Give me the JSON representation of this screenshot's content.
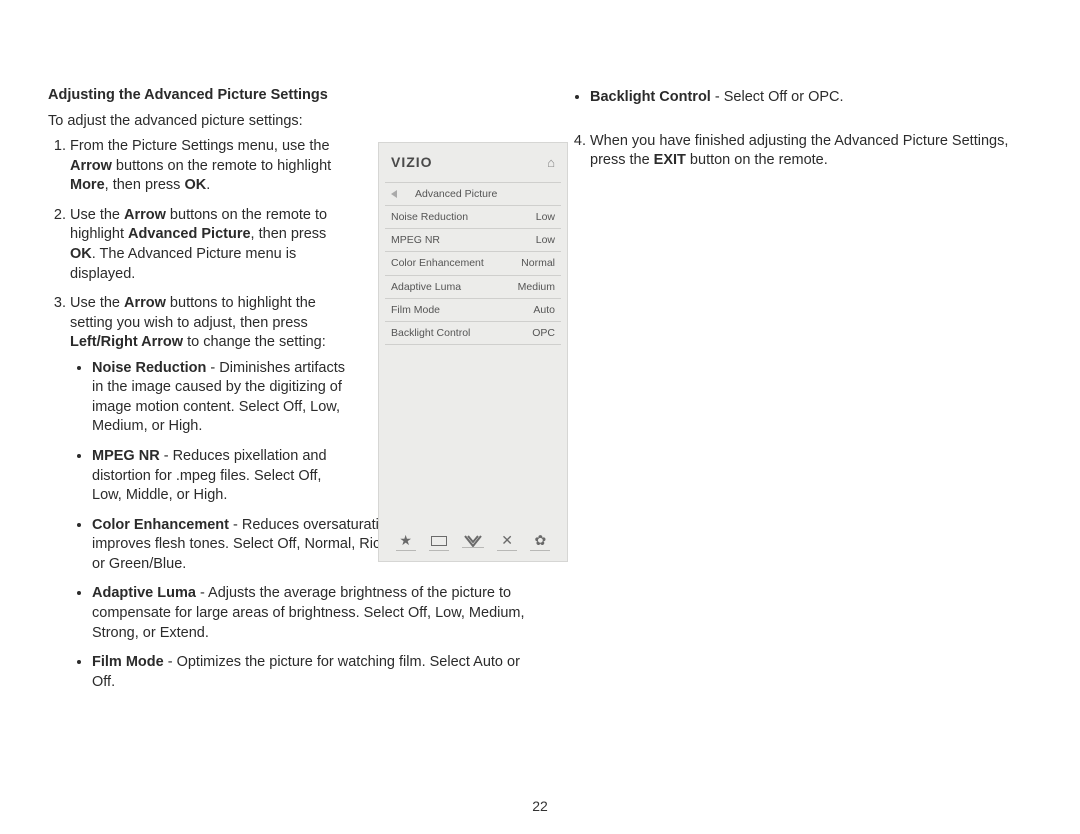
{
  "left": {
    "title": "Adjusting the Advanced Picture Settings",
    "intro": "To adjust the advanced picture settings:",
    "step1_a": "From the Picture Settings menu, use the ",
    "step1_arrow": "Arrow",
    "step1_b": " buttons on the remote to highlight ",
    "step1_more": "More",
    "step1_c": ", then press ",
    "step1_ok": "OK",
    "step1_d": ".",
    "step2_a": "Use the ",
    "step2_arrow": "Arrow",
    "step2_b": " buttons on the remote to highlight ",
    "step2_adv": "Advanced Picture",
    "step2_c": ", then press ",
    "step2_ok": "OK",
    "step2_d": ". The Advanced Picture menu is displayed.",
    "step3_a": "Use the ",
    "step3_arrow": "Arrow",
    "step3_b": " buttons to highlight the setting you wish to adjust, then press ",
    "step3_lr": "Left/Right Arrow",
    "step3_c": " to change the setting:",
    "opt_nr_label": "Noise Reduction",
    "opt_nr_sep": " - ",
    "opt_nr_body": "Diminishes artifacts in the image caused by the digitizing of image motion content. Select Off, Low, Medium, or High.",
    "opt_mpeg_label": "MPEG NR",
    "opt_mpeg_sep": " - ",
    "opt_mpeg_body": "Reduces pixellation and distortion for .mpeg files. Select Off, Low, Middle, or High.",
    "opt_ce_label": "Color Enhancement",
    "opt_ce_sep": " - ",
    "opt_ce_body": "Reduces oversaturation of some colors and improves flesh tones. Select Off, Normal, Rich Color, Green/Flesh, or Green/Blue.",
    "opt_al_label": "Adaptive Luma",
    "opt_al_sep": " - ",
    "opt_al_body": "Adjusts the average brightness of the picture to compensate for large areas of brightness. Select Off, Low, Medium, Strong, or Extend.",
    "opt_fm_label": "Film Mode",
    "opt_fm_sep": " - ",
    "opt_fm_body": "Optimizes the picture for watching film. Select Auto or Off."
  },
  "right": {
    "opt_bl_label": "Backlight Control",
    "opt_bl_sep": " - ",
    "opt_bl_body": "Select Off or OPC.",
    "step4_a": "When you have finished adjusting the Advanced Picture Settings, press the ",
    "step4_exit": "EXIT",
    "step4_b": " button on the remote."
  },
  "panel": {
    "brand": "VIZIO",
    "menu_title": "Advanced Picture",
    "rows": [
      {
        "label": "Noise Reduction",
        "value": "Low"
      },
      {
        "label": "MPEG NR",
        "value": "Low"
      },
      {
        "label": "Color Enhancement",
        "value": "Normal"
      },
      {
        "label": "Adaptive Luma",
        "value": "Medium"
      },
      {
        "label": "Film Mode",
        "value": "Auto"
      },
      {
        "label": "Backlight Control",
        "value": "OPC"
      }
    ],
    "footer_icons": [
      "star",
      "rect",
      "v",
      "x",
      "gear"
    ]
  },
  "page_number": "22"
}
